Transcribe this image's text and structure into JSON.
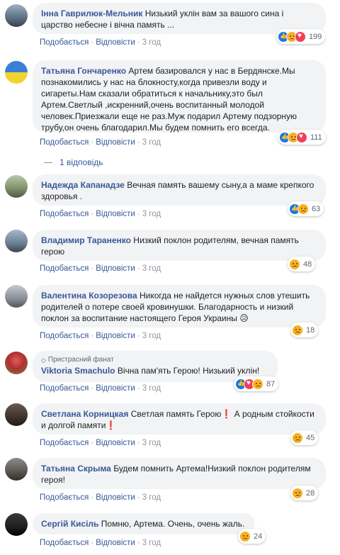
{
  "colors": {
    "link": "#385898",
    "meta": "#90949c",
    "bubble": "#f2f3f5"
  },
  "actions": {
    "like": "Подобається",
    "reply": "Відповісти",
    "sep": "·"
  },
  "comments": [
    {
      "author": "Інна Гаврилюк-Мельник",
      "text": "Низький уклін вам за вашого сина і царство небесне і вічна память ...",
      "time": "3 год",
      "reactions": [
        "like",
        "sad",
        "love"
      ],
      "count": "199"
    },
    {
      "author": "Татьяна Гончаренко",
      "text": "Артем базировался у нас в Бердянске.Мы познакомились у нас на блокносту,когда привезли воду и сигареты.Нам сказали обратиться к начальнику,это был Артем.Светлый ,искренний,очень воспитанный молодой человек.Приезжали еще не раз.Муж подарил Артему подзорную трубу,он очень благодарил.Мы будем помнить его всегда.",
      "time": "3 год",
      "reactions": [
        "like",
        "sad",
        "love"
      ],
      "count": "111",
      "replies": "1 відповідь"
    },
    {
      "author": "Надежда Капанадзе",
      "text": "Вечная память вашему сыну,а а маме крепкого здоровья .",
      "time": "3 год",
      "reactions": [
        "like",
        "sad"
      ],
      "count": "63"
    },
    {
      "author": "Владимир Тараненко",
      "text": "Низкий поклон родителям, вечная память герою",
      "time": "3 год",
      "reactions": [
        "sad"
      ],
      "count": "48"
    },
    {
      "author": "Валентина Козорезова",
      "text": "Никогда не найдется нужных слов утешить родителей о потере своей кровинушки. Благодарность и низкий поклон за воспитание настоящего Героя Украины",
      "emoji": "😥",
      "time": "3 год",
      "reactions": [
        "sad"
      ],
      "count": "18"
    },
    {
      "badge": "Пристрасний фанат",
      "author": "Viktoria Smachulo",
      "text": "Вічна пам'ять Герою! Низький уклін!",
      "time": "3 год",
      "reactions": [
        "like",
        "love",
        "sad"
      ],
      "count": "87"
    },
    {
      "author": "Светлана Корницкая",
      "text": "Светлая память Герою❗ А родным стойкости и долгой памяти❗",
      "time": "3 год",
      "reactions": [
        "sad"
      ],
      "count": "45"
    },
    {
      "author": "Татьяна Скрыма",
      "text": "Будем помнить Артема!Низкий поклон родителям героя!",
      "time": "3 год",
      "reactions": [
        "sad"
      ],
      "count": "28"
    },
    {
      "author": "Сергій Кисіль",
      "text": "Помню, Артема. Очень, очень жаль.",
      "time": "3 год",
      "reactions": [
        "sad"
      ],
      "count": "24"
    }
  ]
}
